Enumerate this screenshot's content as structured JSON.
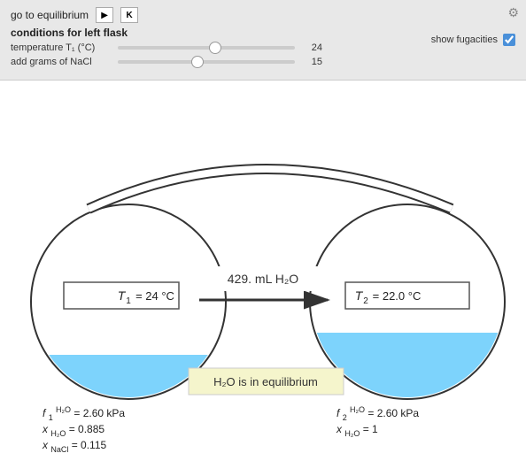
{
  "controls": {
    "go_to_equilibrium_label": "go to equilibrium",
    "play_icon": "▶",
    "reset_icon": "K",
    "conditions_label": "conditions for left flask",
    "temperature_label": "temperature T₁ (°C)",
    "temperature_value": "24",
    "temperature_percent": 55,
    "nacl_label": "add grams of NaCl",
    "nacl_value": "15",
    "nacl_percent": 45,
    "show_fugacities_label": "show fugacities",
    "fugacities_checked": true,
    "settings_icon": "⚙"
  },
  "diagram": {
    "transfer_label": "429. mL H₂O",
    "equilibrium_label": "H₂O is in equilibrium",
    "left_flask": {
      "temp_label": "T₁ = 24 °C",
      "fugacity_label": "f₁H₂O = 2.60 kPa",
      "x_water_label": "xH₂O = 0.885",
      "x_nacl_label": "xNaCl = 0.115"
    },
    "right_flask": {
      "temp_label": "T₂ = 22.0 °C",
      "fugacity_label": "f₂H₂O = 2.60 kPa",
      "x_water_label": "xH₂O = 1"
    }
  }
}
